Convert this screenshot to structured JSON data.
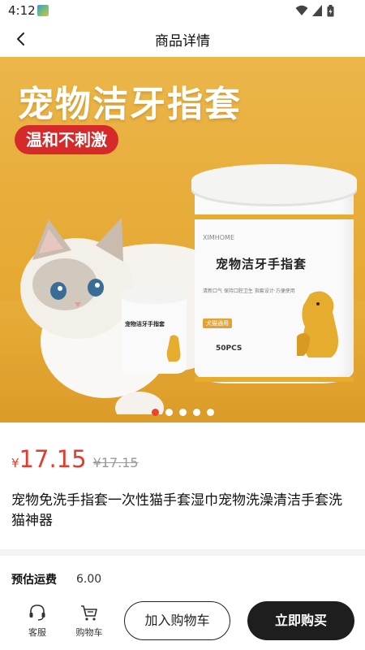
{
  "status_bar": {
    "time": "4:12"
  },
  "header": {
    "title": "商品详情",
    "back_icon": "chevron-left-icon"
  },
  "banner": {
    "headline": "宠物洁牙指套",
    "tag": "温和不刺激",
    "jar_brand": "XIMHOME",
    "jar_name": "宠物洁牙手指套",
    "jar_small_text": "清新口气 保持口腔卫生 指套设计·方便使用",
    "jar_badge": "犬猫通用",
    "jar_pcs": "50PCS",
    "jar_small_name": "宠物洁牙手指套",
    "carousel_total": 5,
    "carousel_active": 1
  },
  "product": {
    "currency": "¥",
    "price": "17.15",
    "original_price": "¥17.15",
    "title": "宠物免洗手指套一次性猫手套湿巾宠物洗澡清洁手套洗猫神器"
  },
  "shipping": {
    "label": "预估运费",
    "value": "6.00"
  },
  "bottom_bar": {
    "service_label": "客服",
    "cart_label": "购物车",
    "add_to_cart": "加入购物车",
    "buy_now": "立即购买"
  },
  "colors": {
    "price_red": "#e33b2e",
    "banner_orange": "#e6aa35",
    "buy_button": "#1e1e1e",
    "tag_red": "#d62a2a"
  }
}
